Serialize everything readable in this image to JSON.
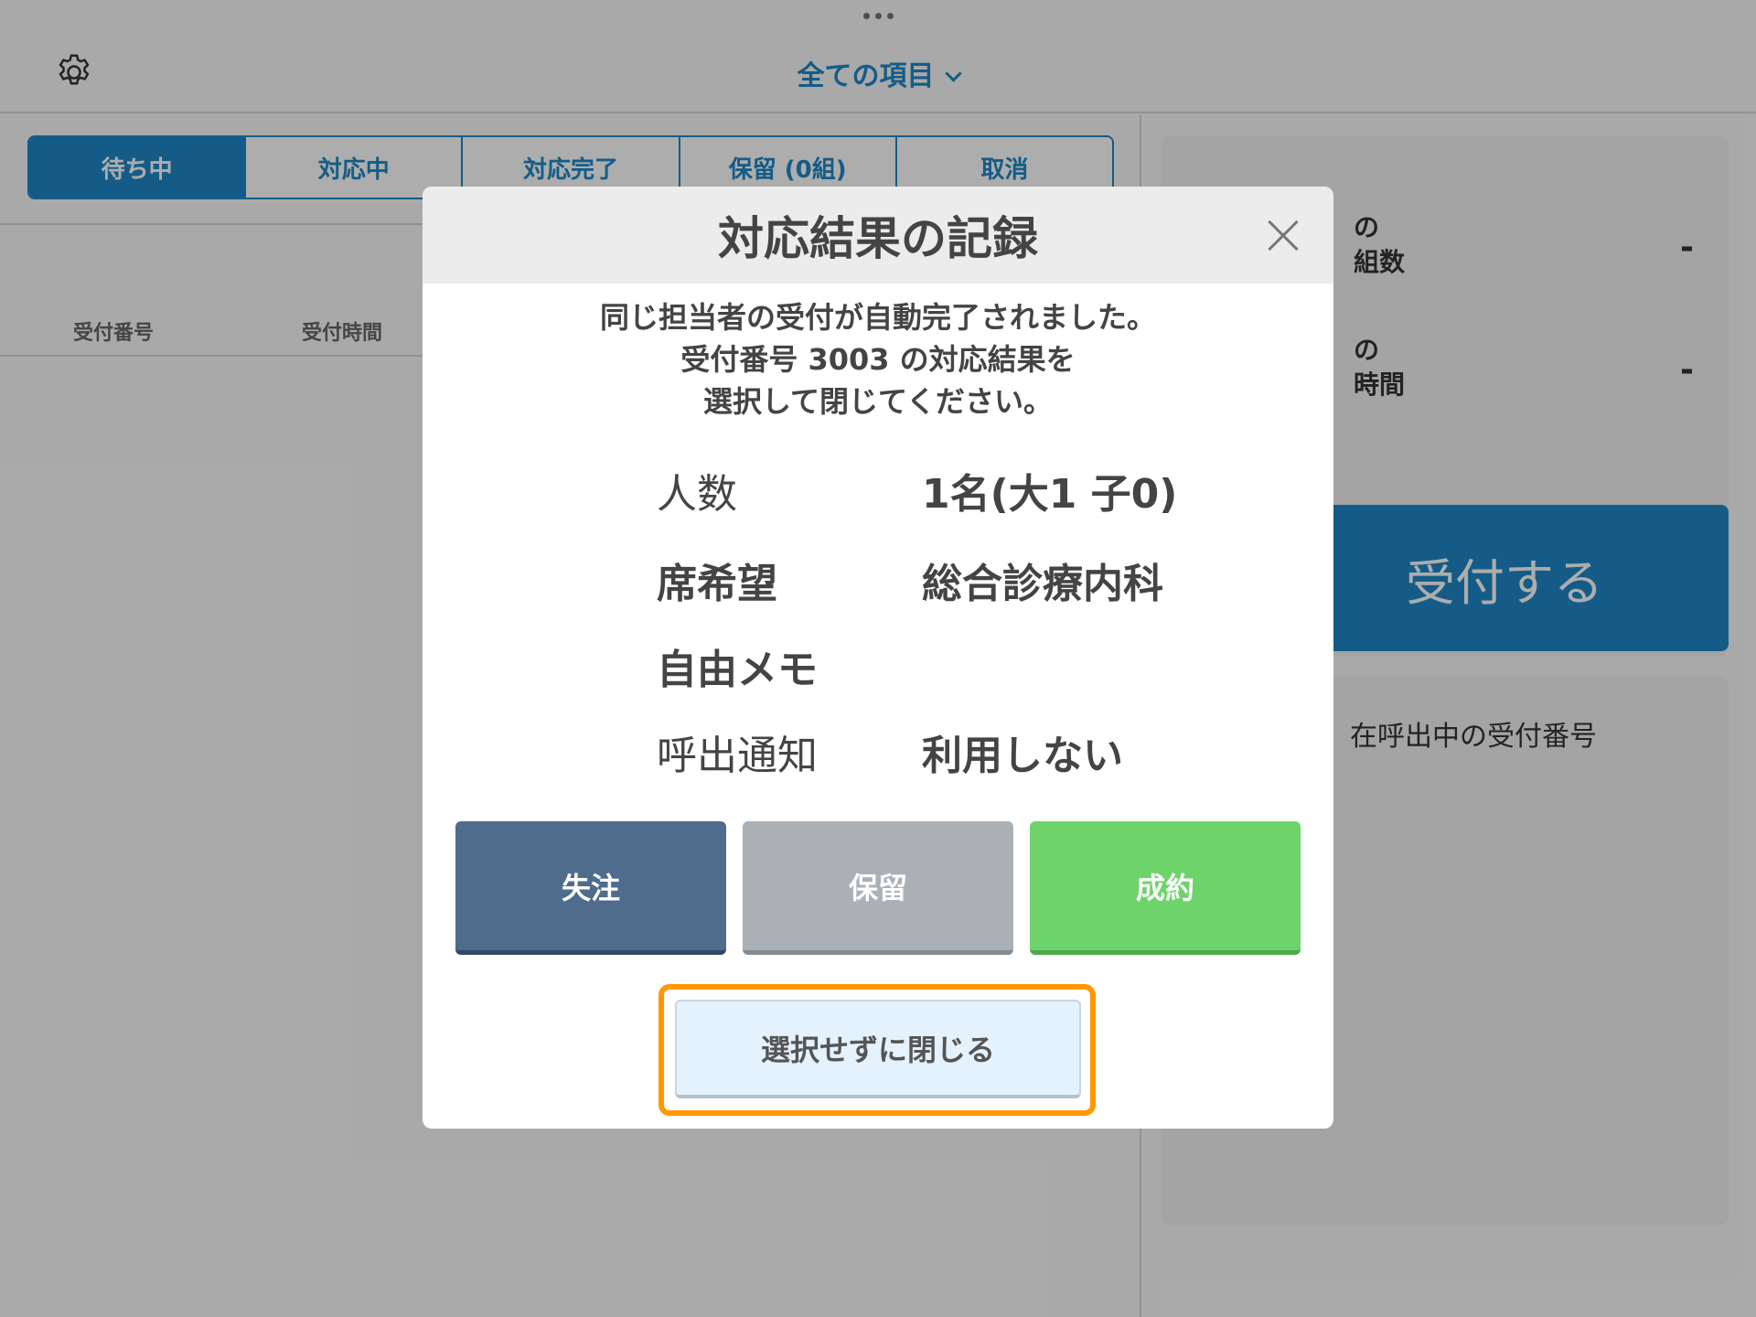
{
  "header": {
    "filter_label": "全ての項目"
  },
  "tabs": [
    {
      "label": "待ち中",
      "active": true
    },
    {
      "label": "対応中",
      "active": false
    },
    {
      "label": "対応完了",
      "active": false
    },
    {
      "label": "保留 (0組)",
      "active": false
    },
    {
      "label": "取消",
      "active": false
    }
  ],
  "table": {
    "columns": [
      "受付番号",
      "受付時間"
    ]
  },
  "stats": {
    "line1_a": "の",
    "line1_b": "組数",
    "value1": "-",
    "line2_a": "の",
    "line2_b": "時間",
    "value2": "-"
  },
  "reception_button": "受付する",
  "calling_label": "在呼出中の受付番号",
  "modal": {
    "title": "対応結果の記録",
    "message": [
      "同じ担当者の受付が自動完了されました。",
      "受付番号 3003 の対応結果を",
      "選択して閉じてください。"
    ],
    "info": [
      {
        "key": "人数",
        "value": "1名(大1 子0)"
      },
      {
        "key": "席希望",
        "value": "総合診療内科"
      },
      {
        "key": "自由メモ",
        "value": ""
      },
      {
        "key": "呼出通知",
        "value": "利用しない"
      }
    ],
    "buttons": {
      "lost": "失注",
      "hold": "保留",
      "won": "成約"
    },
    "close_without_select": "選択せずに閉じる"
  },
  "colors": {
    "accent": "#1e88c8",
    "lost": "#4f6c8c",
    "hold": "#aab1b6",
    "won": "#6fd36b",
    "highlight": "#ff9800"
  }
}
